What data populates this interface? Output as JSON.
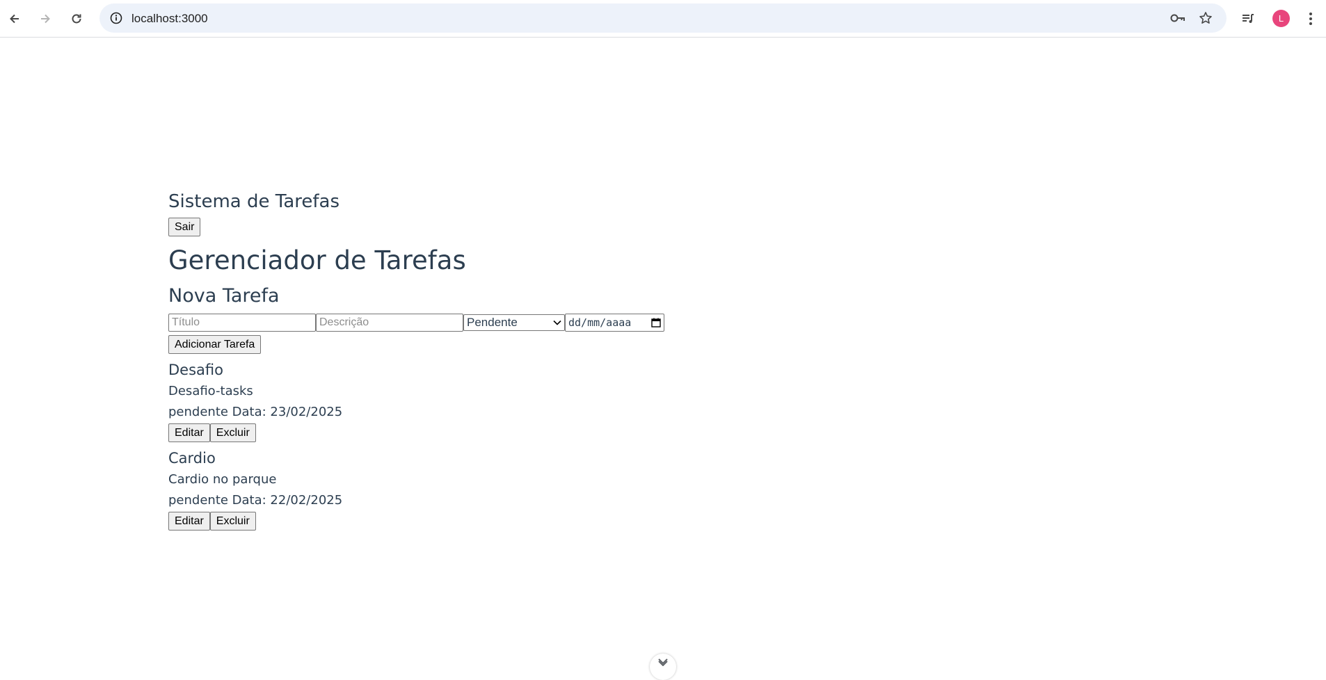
{
  "browser": {
    "url": "localhost:3000",
    "profile_initial": "L",
    "profile_color": "#e8457c",
    "icons": [
      "back-icon",
      "forward-icon",
      "reload-icon",
      "site-info-icon",
      "key-icon",
      "star-icon",
      "media-queue-icon",
      "menu-dots-icon"
    ]
  },
  "header": {
    "app_title": "Sistema de Tarefas",
    "logout_label": "Sair"
  },
  "main": {
    "page_title": "Gerenciador de Tarefas",
    "form": {
      "section_title": "Nova Tarefa",
      "title_placeholder": "Título",
      "description_placeholder": "Descrição",
      "status_selected": "Pendente",
      "date_placeholder": "dd/mm/aaaa",
      "add_label": "Adicionar Tarefa"
    },
    "tasks": [
      {
        "title": "Desafio",
        "description": "Desafio-tasks",
        "status_date": "pendente Data: 23/02/2025",
        "edit_label": "Editar",
        "delete_label": "Excluir"
      },
      {
        "title": "Cardio",
        "description": "Cardio no parque",
        "status_date": "pendente Data: 22/02/2025",
        "edit_label": "Editar",
        "delete_label": "Excluir"
      }
    ]
  },
  "colors": {
    "text": "#2c3e50",
    "omnibox": "#edf2fa",
    "button_bg": "#efefef"
  }
}
